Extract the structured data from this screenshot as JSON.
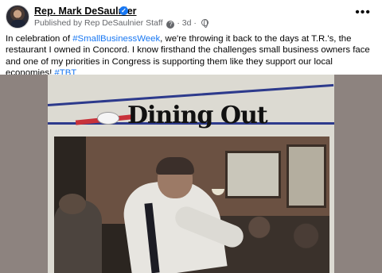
{
  "post": {
    "author": "Rep. Mark DeSaulnier",
    "published_by": "Published by Rep DeSaulnier Staff",
    "time": "3d",
    "text_parts": [
      "In celebration of ",
      "#SmallBusinessWeek",
      ", we're throwing it back to the days at T.R.'s, the restaurant I owned in Concord. I know firsthand the challenges small business owners face and one of my priorities in Congress is supporting them like they support our local economies! ",
      "#TBT"
    ],
    "more_label": "•••"
  },
  "image": {
    "headline": "Dining Out"
  },
  "colors": {
    "link": "#1877f2",
    "verified": "#1877f2",
    "muted": "#65676b"
  }
}
